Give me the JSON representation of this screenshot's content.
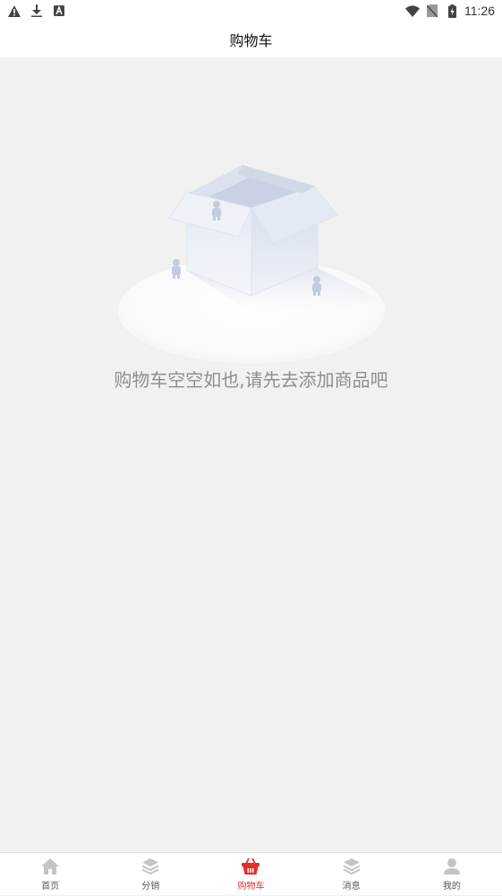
{
  "status_bar": {
    "time": "11:26",
    "left_icons": [
      "warning-icon",
      "download-icon",
      "app-a-icon"
    ],
    "right_icons": [
      "wifi-icon",
      "no-sim-icon",
      "battery-charging-icon"
    ]
  },
  "header": {
    "title": "购物车"
  },
  "empty_state": {
    "message": "购物车空空如也,请先去添加商品吧",
    "illustration": "empty-box-illustration"
  },
  "tab_bar": {
    "active_index": 2,
    "active_color": "#e0302f",
    "inactive_color": "#c4c4c4",
    "tabs": [
      {
        "label": "首页",
        "icon": "home-icon"
      },
      {
        "label": "分销",
        "icon": "layers-icon"
      },
      {
        "label": "购物车",
        "icon": "basket-icon"
      },
      {
        "label": "消息",
        "icon": "layers-icon"
      },
      {
        "label": "我的",
        "icon": "user-icon"
      }
    ]
  }
}
